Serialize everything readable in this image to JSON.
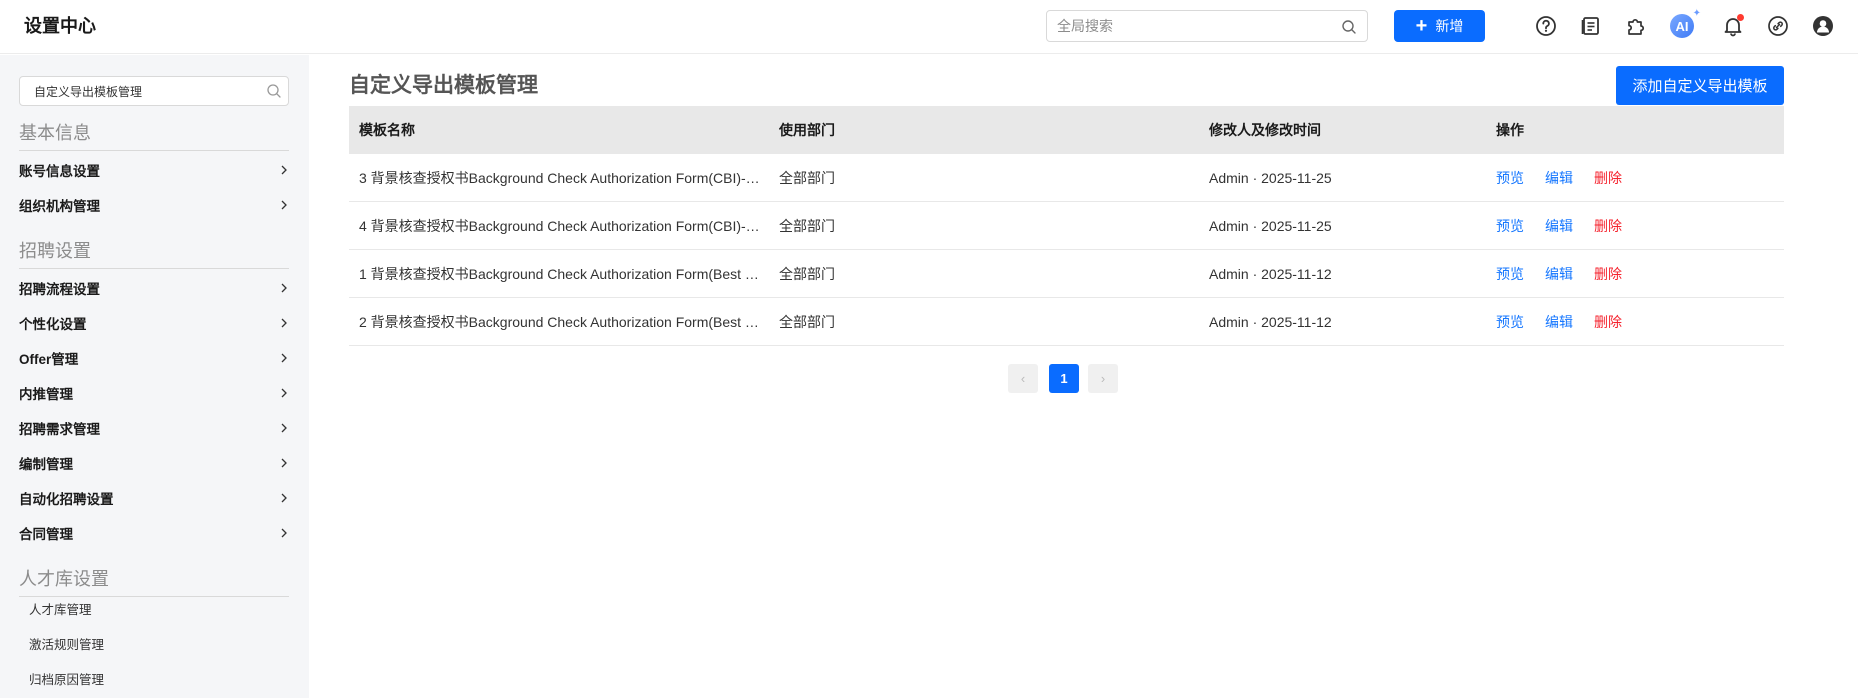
{
  "header": {
    "app_title": "设置中心",
    "search_placeholder": "全局搜索",
    "new_button_label": "新增",
    "ai_label": "AI",
    "icons": [
      "help-icon",
      "document-icon",
      "puzzle-icon",
      "ai-icon",
      "bell-icon",
      "link-icon",
      "user-avatar-icon"
    ],
    "accent_color": "#0a6cff"
  },
  "sidebar": {
    "search_value": "自定义导出模板管理",
    "sections": [
      {
        "title": "基本信息",
        "items": [
          "账号信息设置",
          "组织机构管理"
        ]
      },
      {
        "title": "招聘设置",
        "items": [
          "招聘流程设置",
          "个性化设置",
          "Offer管理",
          "内推管理",
          "招聘需求管理",
          "编制管理",
          "自动化招聘设置",
          "合同管理"
        ]
      },
      {
        "title": "人才库设置",
        "subitems": [
          "人才库管理",
          "激活规则管理",
          "归档原因管理"
        ]
      }
    ]
  },
  "main": {
    "page_title": "自定义导出模板管理",
    "add_button_label": "添加自定义导出模板",
    "columns": [
      "模板名称",
      "使用部门",
      "修改人及修改时间",
      "操作"
    ],
    "rows": [
      {
        "name": "3 背景核查授权书Background Check Authorization Form(CBI)-…",
        "dept": "全部部门",
        "modified": "Admin · 2025-11-25"
      },
      {
        "name": "4 背景核查授权书Background Check Authorization Form(CBI)-…",
        "dept": "全部部门",
        "modified": "Admin · 2025-11-25"
      },
      {
        "name": "1 背景核查授权书Background Check Authorization Form(Best …",
        "dept": "全部部门",
        "modified": "Admin · 2025-11-12"
      },
      {
        "name": "2 背景核查授权书Background Check Authorization Form(Best …",
        "dept": "全部部门",
        "modified": "Admin · 2025-11-12"
      }
    ],
    "actions": {
      "preview": "预览",
      "edit": "编辑",
      "delete": "删除"
    },
    "pagination": {
      "current_page": "1",
      "prev": "‹",
      "next": "›"
    }
  }
}
